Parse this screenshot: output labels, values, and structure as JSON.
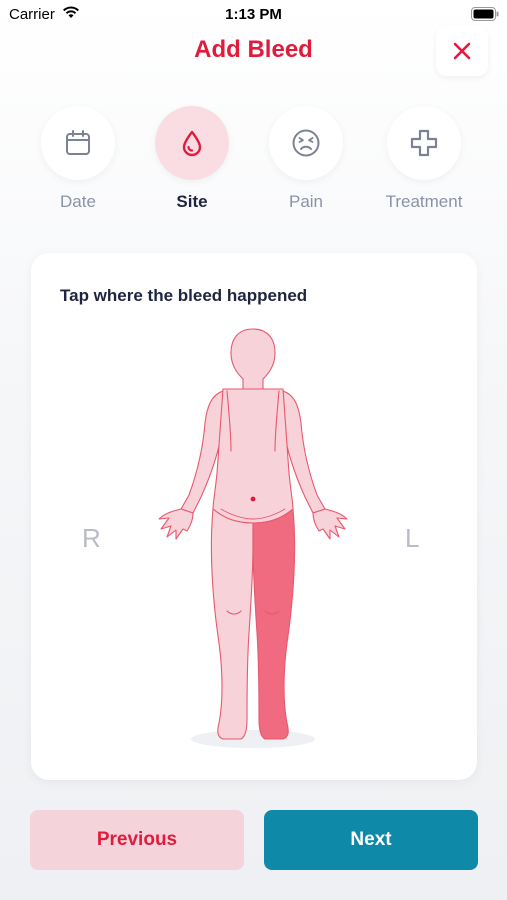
{
  "status_bar": {
    "carrier": "Carrier",
    "time": "1:13 PM"
  },
  "header": {
    "title": "Add Bleed"
  },
  "steps": [
    {
      "label": "Date",
      "icon": "calendar-icon",
      "active": false
    },
    {
      "label": "Site",
      "icon": "blood-drop-icon",
      "active": true
    },
    {
      "label": "Pain",
      "icon": "pain-face-icon",
      "active": false
    },
    {
      "label": "Treatment",
      "icon": "medical-cross-icon",
      "active": false
    }
  ],
  "card": {
    "instruction": "Tap where the bleed happened",
    "right_label": "R",
    "left_label": "L",
    "selected_region": "left-leg"
  },
  "colors": {
    "accent": "#e11b3c",
    "body_fill": "#f7d2d8",
    "selected_fill": "#f06a80",
    "next_button": "#0e8aa8",
    "previous_button": "#f4d3da"
  },
  "footer": {
    "previous_label": "Previous",
    "next_label": "Next"
  }
}
